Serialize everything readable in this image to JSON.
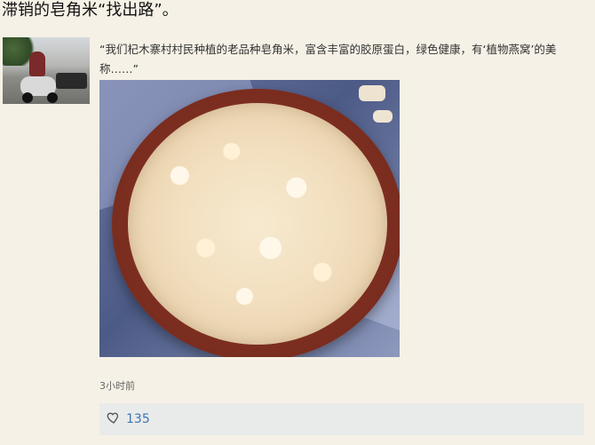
{
  "post": {
    "title": "滞销的皂角米“找出路”。",
    "excerpt": "“我们杞木寨村村民种植的老品种皂角米，富含丰富的胶原蛋白，绿色健康，有‘植物燕窝’的美称……”",
    "time_ago": "3小时前"
  },
  "actions": {
    "like_count": "135",
    "like_icon": "heart-outline-icon"
  }
}
